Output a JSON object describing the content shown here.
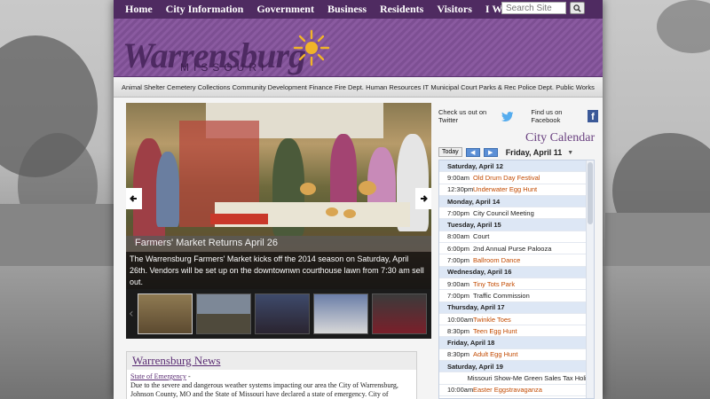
{
  "topnav": {
    "items": [
      "Home",
      "City Information",
      "Government",
      "Business",
      "Residents",
      "Visitors",
      "I Want To..."
    ],
    "search_placeholder": "Search Site"
  },
  "banner": {
    "logo_text": "Warrensburg",
    "logo_sub": "MISSOURI"
  },
  "subnav": {
    "items": [
      "Animal Shelter",
      "Cemetery",
      "Collections",
      "Community Development",
      "Finance",
      "Fire Dept.",
      "Human Resources",
      "IT",
      "Municipal Court",
      "Parks & Rec",
      "Police Dept.",
      "Public Works"
    ]
  },
  "slideshow": {
    "caption_title": "Farmers' Market Returns April 26",
    "caption_body": "The Warrensburg Farmers' Market kicks off the 2014 season on Saturday, April 26th. Vendors will be set up on the downtownwn courthouse lawn from 7:30 am sell out."
  },
  "news": {
    "heading": "Warrensburg News",
    "item_title": "State of Emergency",
    "item_title_suffix": " -",
    "item_body": "Due to the severe and dangerous weather systems impacting our area the City of Warrensburg, Johnson County, MO and the State of Missouri have declared a state of emergency. City of"
  },
  "social": {
    "twitter_label": "Check us out on Twitter",
    "facebook_label": "Find us on Facebook"
  },
  "calendar": {
    "title": "City Calendar",
    "today_label": "Today",
    "current_date": "Friday, April 11",
    "rows": [
      {
        "type": "day",
        "label": "Saturday, April 12"
      },
      {
        "type": "event",
        "time": "9:00am",
        "title": "Old Drum Day Festival",
        "highlight": true
      },
      {
        "type": "event",
        "time": "12:30pm",
        "title": "Underwater Egg Hunt",
        "highlight": true
      },
      {
        "type": "day",
        "label": "Monday, April 14"
      },
      {
        "type": "event",
        "time": "7:00pm",
        "title": "City Council Meeting",
        "highlight": false
      },
      {
        "type": "day",
        "label": "Tuesday, April 15"
      },
      {
        "type": "event",
        "time": "8:00am",
        "title": "Court",
        "highlight": false
      },
      {
        "type": "event",
        "time": "6:00pm",
        "title": "2nd Annual Purse Palooza",
        "highlight": false
      },
      {
        "type": "event",
        "time": "7:00pm",
        "title": "Ballroom Dance",
        "highlight": true
      },
      {
        "type": "day",
        "label": "Wednesday, April 16"
      },
      {
        "type": "event",
        "time": "9:00am",
        "title": "Tiny Tots Park",
        "highlight": true
      },
      {
        "type": "event",
        "time": "7:00pm",
        "title": "Traffic Commission",
        "highlight": false
      },
      {
        "type": "day",
        "label": "Thursday, April 17"
      },
      {
        "type": "event",
        "time": "10:00am",
        "title": "Twinkle Toes",
        "highlight": true
      },
      {
        "type": "event",
        "time": "8:30pm",
        "title": "Teen Egg Hunt",
        "highlight": true
      },
      {
        "type": "day",
        "label": "Friday, April 18"
      },
      {
        "type": "event",
        "time": "8:30pm",
        "title": "Adult Egg Hunt",
        "highlight": true
      },
      {
        "type": "day",
        "label": "Saturday, April 19"
      },
      {
        "type": "event",
        "time": "",
        "title": "Missouri Show-Me Green Sales Tax Holida",
        "highlight": false
      },
      {
        "type": "event",
        "time": "10:00am",
        "title": "Easter Eggstravaganza",
        "highlight": true
      }
    ]
  },
  "colors": {
    "brand_purple": "#4f2b61",
    "event_orange": "#c24a00",
    "day_header_blue": "#dde7f5"
  }
}
